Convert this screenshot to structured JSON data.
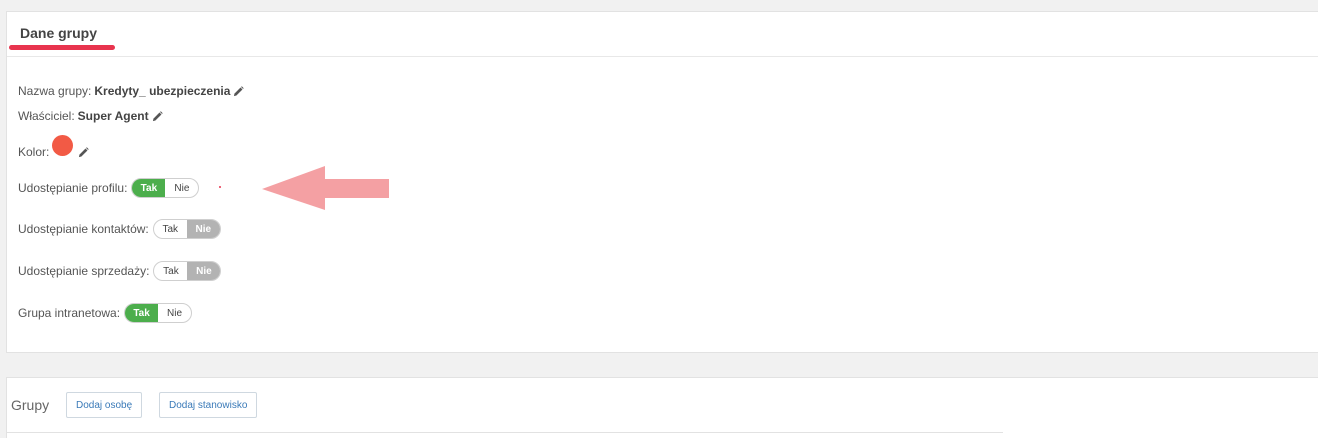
{
  "group_panel": {
    "title": "Dane grupy",
    "name_label": "Nazwa grupy:",
    "name_value": "Kredyty_ ubezpieczenia",
    "owner_label": "Właściciel:",
    "owner_value": "Super Agent",
    "color_label": "Kolor:",
    "color_value": "#f25a45",
    "accent_color": "#e8344e",
    "toggle_on_color": "#4cae4c",
    "toggles": [
      {
        "label": "Udostępianie profilu:",
        "yes": "Tak",
        "no": "Nie",
        "selected": "Tak"
      },
      {
        "label": "Udostępianie kontaktów:",
        "yes": "Tak",
        "no": "Nie",
        "selected": "Nie"
      },
      {
        "label": "Udostępianie sprzedaży:",
        "yes": "Tak",
        "no": "Nie",
        "selected": "Nie"
      },
      {
        "label": "Grupa intranetowa:",
        "yes": "Tak",
        "no": "Nie",
        "selected": "Tak"
      }
    ],
    "annotation": {
      "icon": "arrow-left-icon",
      "color": "#f4a0a3"
    }
  },
  "groups_panel": {
    "title": "Grupy",
    "add_person_label": "Dodaj osobę",
    "add_position_label": "Dodaj stanowisko"
  }
}
